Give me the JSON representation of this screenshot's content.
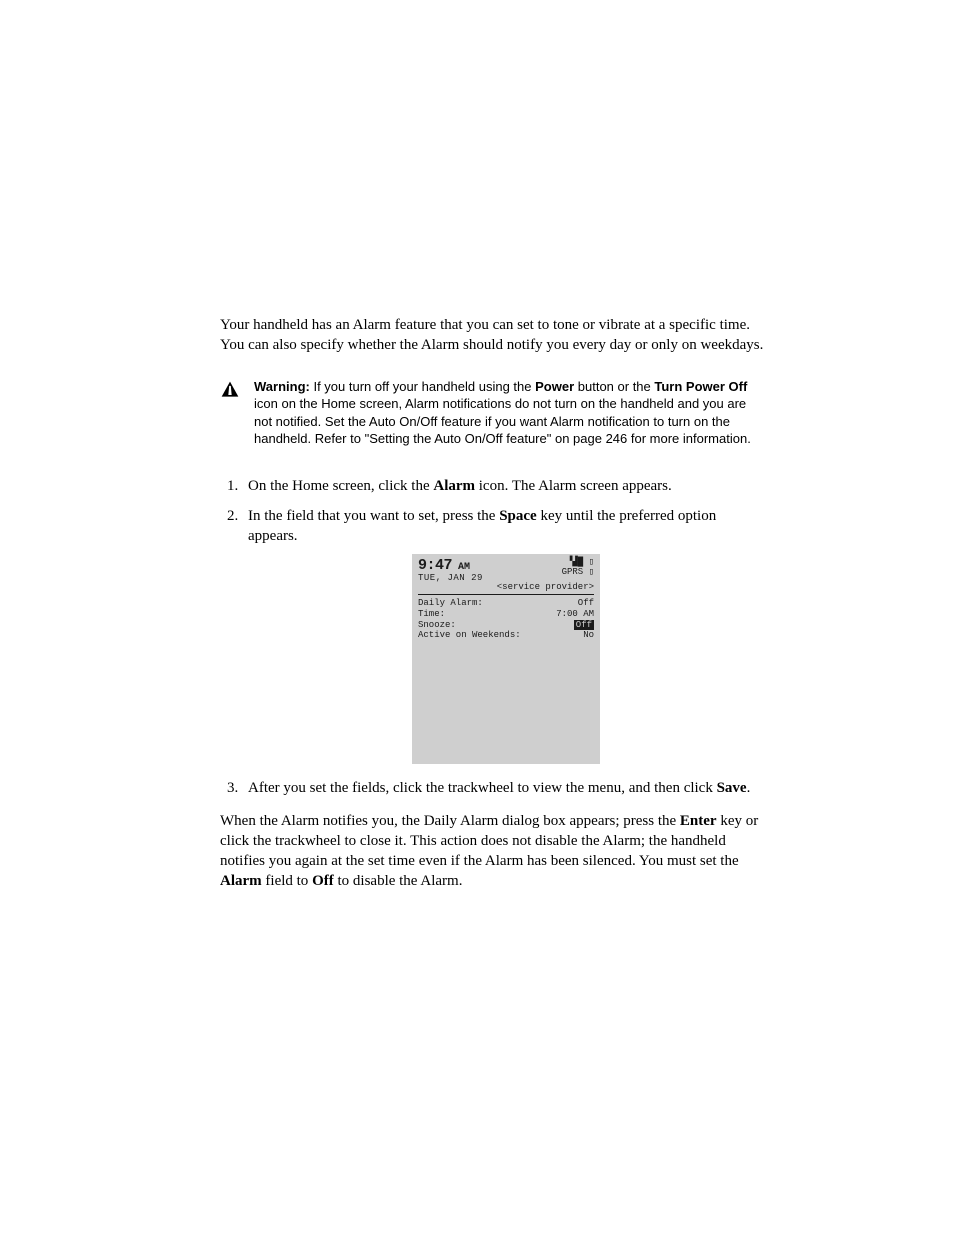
{
  "intro": "Your handheld has an Alarm feature that you can set to tone or vibrate at a specific time. You can also specify whether the Alarm should notify you every day or only on weekdays.",
  "warning": {
    "label": "Warning:",
    "part1": "If you turn off your handheld using the",
    "btnword": "Power",
    "part2": "button or the",
    "iconword": "Turn Power Off",
    "part3": "icon on the Home screen, Alarm notifications do not turn on the handheld and you are not notified. Set the Auto On/Off feature if you want Alarm notification to turn on the handheld. Refer to \"Setting the Auto On/Off feature\" on page 246 for more information."
  },
  "steps": {
    "s1a": "On the Home screen, click the ",
    "s1b": "Alarm",
    "s1c": " icon. The Alarm screen appears.",
    "s2a": "In the field that you want to set, press the ",
    "s2b": "Space",
    "s2c": " key until the preferred option appears.",
    "s3a": "After you set the fields, click the trackwheel to view the menu, and then click ",
    "s3b": "Save",
    "s3c": "."
  },
  "screen": {
    "time": "9:47",
    "ampm": "AM",
    "date": "TUE, JAN 29",
    "signal": "▝▟█ ▯",
    "network": "GPRS ▯",
    "provider": "<service provider>",
    "rows": [
      {
        "label": "Daily Alarm:",
        "value": "Off",
        "inv": false
      },
      {
        "label": "Time:",
        "value": "7:00 AM",
        "inv": false
      },
      {
        "label": "Snooze:",
        "value": "Off",
        "inv": true
      },
      {
        "label": "Active on Weekends:",
        "value": "No",
        "inv": false
      }
    ]
  },
  "closing": {
    "p1a": "When the Alarm notifies you, the Daily Alarm dialog box appears; press the ",
    "p1b": "Enter",
    "p1c": " key or click the trackwheel to close it. This action does not disable the Alarm; the handheld notifies you again at the set time even if the Alarm has been silenced. You must set the ",
    "p1d": "Alarm",
    "p1e": " field to ",
    "p1f": "Off",
    "p1g": " to disable the Alarm."
  }
}
